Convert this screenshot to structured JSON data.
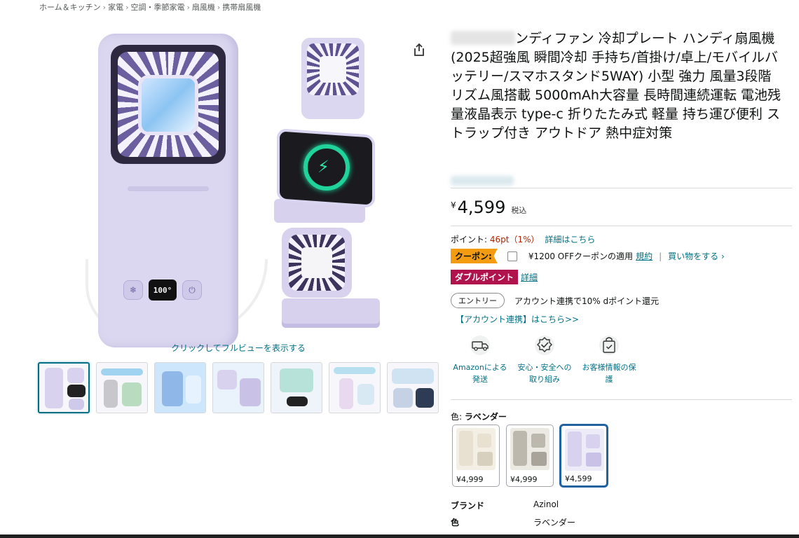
{
  "breadcrumb": [
    "ホーム＆キッチン",
    "家電",
    "空調・季節家電",
    "扇風機",
    "携帯扇風機"
  ],
  "main_image": {
    "display_text": "100°",
    "fullview_link": "クリックしてフルビューを表示する"
  },
  "thumbnails": [
    {
      "label": "thumbnail-1",
      "active": true
    },
    {
      "label": "thumbnail-2",
      "active": false
    },
    {
      "label": "thumbnail-3",
      "active": false
    },
    {
      "label": "thumbnail-4",
      "active": false
    },
    {
      "label": "thumbnail-5",
      "active": false
    },
    {
      "label": "thumbnail-6",
      "active": false
    },
    {
      "label": "thumbnail-7",
      "active": false
    }
  ],
  "product": {
    "title_visible": "ンディファン 冷却プレート ハンディ扇風機 (2025超強風 瞬間冷却 手持ち/首掛け/卓上/モバイルバッテリー/スマホスタンド5WAY) 小型 強力 風量3段階 リズム風搭載 5000mAh大容量 長時間連続運転 電池残量液晶表示 type-c 折りたたみ式 軽量 持ち運び便利 ストラップ付き アウトドア 熱中症対策",
    "price_symbol": "¥",
    "price_amount": "4,599",
    "price_tax": "税込"
  },
  "points": {
    "label": "ポイント:",
    "value": "46pt（1%）",
    "link": "詳細はこちら"
  },
  "coupon": {
    "badge": "クーポン:",
    "text": "¥1200 OFFクーポンの適用",
    "terms_link": "規約",
    "separator": "|",
    "shop_link": "買い物をする ›"
  },
  "double_point": {
    "badge": "ダブルポイント",
    "link": "詳細"
  },
  "entry": {
    "button": "エントリー",
    "text": "アカウント連携で10% dポイント還元",
    "account_link": "【アカウント連携】はこちら>>"
  },
  "features": [
    {
      "icon": "truck-icon",
      "label": "Amazonによる発送"
    },
    {
      "icon": "badge-check-icon",
      "label": "安心・安全への取り組み"
    },
    {
      "icon": "shield-bag-icon",
      "label": "お客様情報の保護"
    }
  ],
  "color": {
    "label": "色:",
    "selected": "ラベンダー",
    "swatches": [
      {
        "price": "¥4,999",
        "tone": "#e8e1d2",
        "active": false
      },
      {
        "price": "¥4,999",
        "tone": "#bdb8ae",
        "active": false
      },
      {
        "price": "¥4,599",
        "tone": "#d8d2ef",
        "active": true
      }
    ]
  },
  "specs": [
    {
      "key": "ブランド",
      "value": "Azinol"
    },
    {
      "key": "色",
      "value": "ラベンダー"
    }
  ],
  "colors": {
    "link": "#007185",
    "price_red": "#b12704",
    "coupon_orange": "#f39c12",
    "double_badge": "#b0134b",
    "swatch_selected": "#2162a1"
  }
}
